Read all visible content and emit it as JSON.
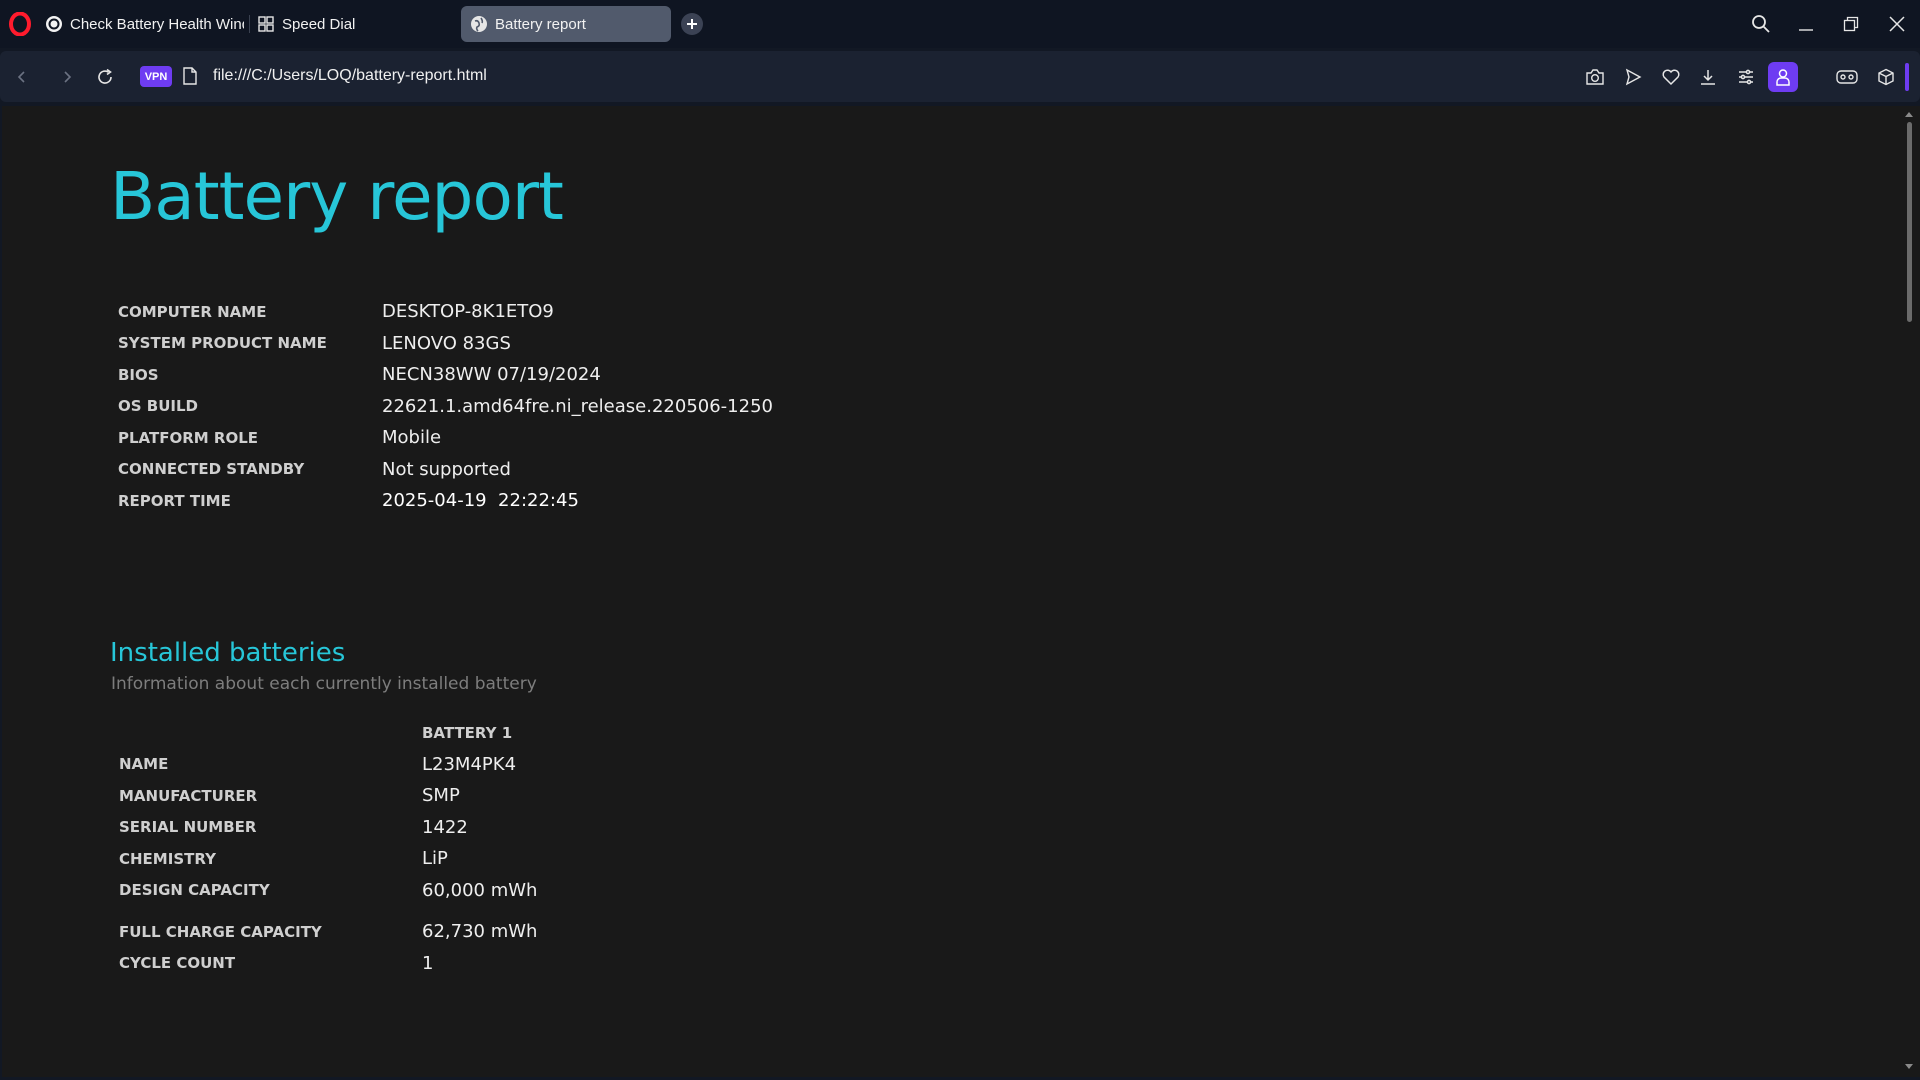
{
  "browser": {
    "tabs": [
      {
        "label": "Check Battery Health Windows",
        "icon": "openai-icon",
        "active": false
      },
      {
        "label": "Speed Dial",
        "icon": "speed-dial-icon",
        "active": false
      },
      {
        "label": "Battery report",
        "icon": "globe-icon",
        "active": true
      }
    ],
    "vpn_label": "VPN",
    "url": "file:///C:/Users/LOQ/battery-report.html",
    "accent_color": "#6e3cf2"
  },
  "report": {
    "title": "Battery report",
    "system_info": [
      {
        "label": "COMPUTER NAME",
        "value": "DESKTOP-8K1ETO9"
      },
      {
        "label": "SYSTEM PRODUCT NAME",
        "value": "LENOVO 83GS"
      },
      {
        "label": "BIOS",
        "value": "NECN38WW 07/19/2024"
      },
      {
        "label": "OS BUILD",
        "value": "22621.1.amd64fre.ni_release.220506-1250"
      },
      {
        "label": "PLATFORM ROLE",
        "value": "Mobile"
      },
      {
        "label": "CONNECTED STANDBY",
        "value": "Not supported"
      },
      {
        "label": "REPORT TIME",
        "value": "2025-04-19  22:22:45"
      }
    ],
    "installed_batteries": {
      "heading": "Installed batteries",
      "description": "Information about each currently installed battery",
      "column_header": "BATTERY 1",
      "rows": [
        {
          "label": "NAME",
          "value": "L23M4PK4"
        },
        {
          "label": "MANUFACTURER",
          "value": "SMP"
        },
        {
          "label": "SERIAL NUMBER",
          "value": "1422"
        },
        {
          "label": "CHEMISTRY",
          "value": "LiP"
        },
        {
          "label": "DESIGN CAPACITY",
          "value": "60,000 mWh"
        },
        {
          "label": "FULL CHARGE CAPACITY",
          "value": "62,730 mWh"
        },
        {
          "label": "CYCLE COUNT",
          "value": "1"
        }
      ]
    },
    "title_color": "#27c6d8"
  }
}
